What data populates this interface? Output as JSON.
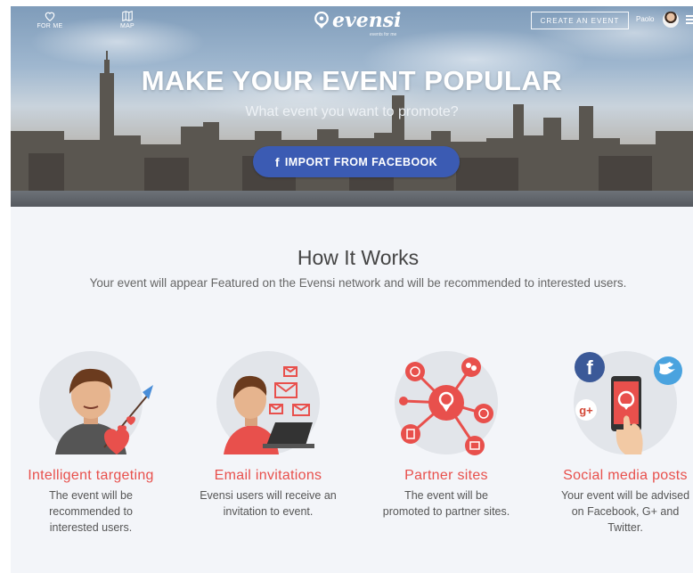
{
  "nav": {
    "for_me": "FOR ME",
    "map": "MAP",
    "logo": "evensi",
    "logo_tagline": "events for me",
    "create_event": "CREATE AN EVENT",
    "user_name": "Paolo"
  },
  "hero": {
    "title": "MAKE YOUR EVENT POPULAR",
    "subtitle": "What event you want to promote?",
    "import_button": "IMPORT FROM FACEBOOK",
    "facebook_glyph": "f"
  },
  "how": {
    "title": "How It Works",
    "subtitle": "Your event will appear Featured on the Evensi network and will be recommended to interested users."
  },
  "features": [
    {
      "title": "Intelligent targeting",
      "desc_lines": [
        "The event will be",
        "recommended to",
        "interested users."
      ]
    },
    {
      "title": "Email invitations",
      "desc_lines": [
        "Evensi users will receive an",
        "invitation to event."
      ]
    },
    {
      "title": "Partner sites",
      "desc_lines": [
        "The event will be",
        "promoted to partner sites."
      ]
    },
    {
      "title": "Social media posts",
      "desc_lines": [
        "Your event will be advised",
        "on Facebook, G+ and",
        "Twitter."
      ]
    }
  ],
  "colors": {
    "accent": "#e8504c",
    "facebook": "#3b5bb3",
    "section_bg": "#f3f5f9"
  }
}
